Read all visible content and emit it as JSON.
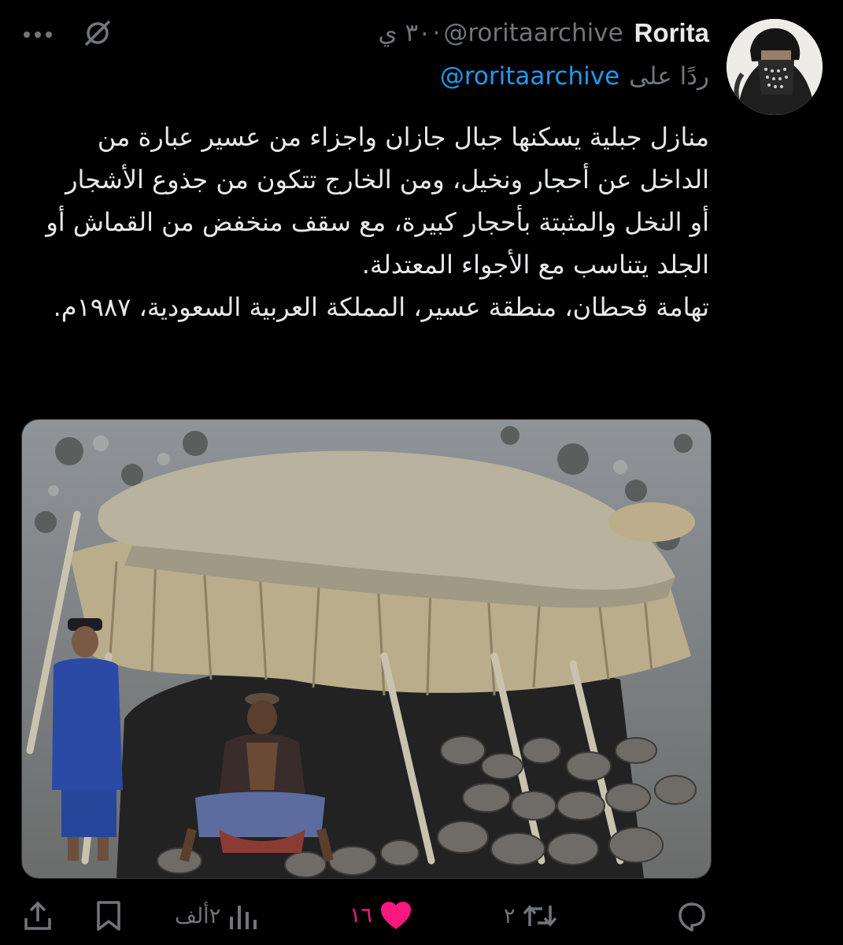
{
  "tweet": {
    "display_name": "Rorita",
    "handle": "@roritaarchive",
    "time": "٣٠ ي",
    "reply_label": "ردًا على",
    "reply_handle": "@roritaarchive",
    "text": "منازل جبلية يسكنها جبال جازان واجزاء من عسير عبارة من الداخل عن أحجار ونخيل، ومن الخارج تتكون من جذوع الأشجار أو النخل والمثبتة بأحجار كبيرة، مع سقف منخفض من القماش أو الجلد يتناسب مع الأجواء المعتدلة.\nتهامة قحطان، منطقة عسير، المملكة العربية السعودية، ١٩٨٧م."
  },
  "icons": {
    "more": "more-horizontal-icon",
    "grok": "grok-icon",
    "reply": "speech-bubble-icon",
    "repost": "repost-icon",
    "like": "heart-icon",
    "views": "bar-chart-icon",
    "bookmark": "bookmark-icon",
    "share": "share-icon"
  },
  "actions": {
    "reply_count": "",
    "repost_count": "٢",
    "like_count": "١٦",
    "views_count": "٢ألف"
  },
  "colors": {
    "background": "#000000",
    "text": "#e7e9ea",
    "muted": "#71767b",
    "link": "#1d9bf0",
    "like": "#f91880"
  }
}
